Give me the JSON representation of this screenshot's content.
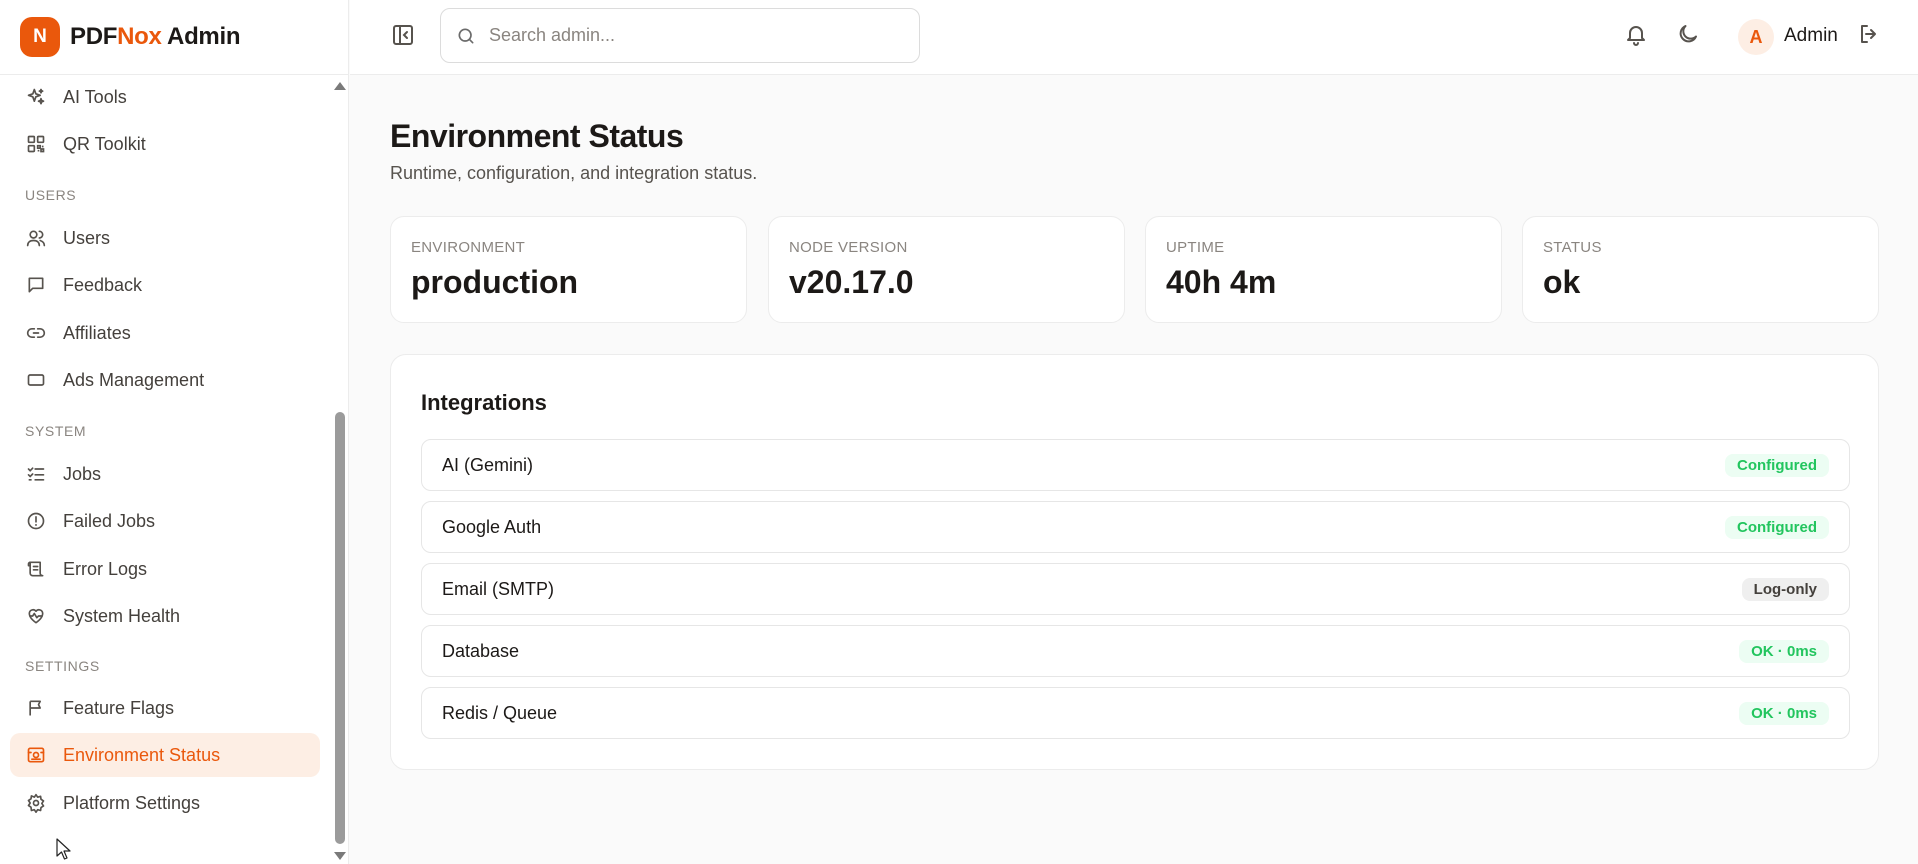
{
  "brand": {
    "logo_letter": "N",
    "name_part1": "PDF",
    "name_accent": "Nox",
    "name_part2": " Admin",
    "accent_color": "#ea580c"
  },
  "sidebar": {
    "items_top": [
      {
        "label": "AI Tools",
        "icon": "sparkles-icon"
      },
      {
        "label": "QR Toolkit",
        "icon": "qr-code-icon"
      }
    ],
    "sections": [
      {
        "label": "USERS",
        "items": [
          {
            "label": "Users",
            "icon": "users-icon"
          },
          {
            "label": "Feedback",
            "icon": "message-square-icon"
          },
          {
            "label": "Affiliates",
            "icon": "link-icon"
          },
          {
            "label": "Ads Management",
            "icon": "rectangle-icon"
          }
        ]
      },
      {
        "label": "SYSTEM",
        "items": [
          {
            "label": "Jobs",
            "icon": "list-checks-icon"
          },
          {
            "label": "Failed Jobs",
            "icon": "alert-circle-icon"
          },
          {
            "label": "Error Logs",
            "icon": "scroll-icon"
          },
          {
            "label": "System Health",
            "icon": "heart-pulse-icon"
          }
        ]
      },
      {
        "label": "SETTINGS",
        "items": [
          {
            "label": "Feature Flags",
            "icon": "flag-icon"
          },
          {
            "label": "Environment Status",
            "icon": "server-status-icon",
            "active": true
          },
          {
            "label": "Platform Settings",
            "icon": "gear-icon"
          }
        ]
      }
    ]
  },
  "header": {
    "search_placeholder": "Search admin...",
    "user_initial": "A",
    "user_name": "Admin"
  },
  "page": {
    "title": "Environment Status",
    "subtitle": "Runtime, configuration, and integration status."
  },
  "stats": [
    {
      "label": "ENVIRONMENT",
      "value": "production"
    },
    {
      "label": "NODE VERSION",
      "value": "v20.17.0"
    },
    {
      "label": "UPTIME",
      "value": "40h 4m"
    },
    {
      "label": "STATUS",
      "value": "ok"
    }
  ],
  "integrations": {
    "title": "Integrations",
    "rows": [
      {
        "name": "AI (Gemini)",
        "status": "Configured",
        "tone": "green"
      },
      {
        "name": "Google Auth",
        "status": "Configured",
        "tone": "green"
      },
      {
        "name": "Email (SMTP)",
        "status": "Log-only",
        "tone": "gray"
      },
      {
        "name": "Database",
        "status": "OK · 0ms",
        "tone": "green"
      },
      {
        "name": "Redis / Queue",
        "status": "OK · 0ms",
        "tone": "green"
      }
    ]
  }
}
